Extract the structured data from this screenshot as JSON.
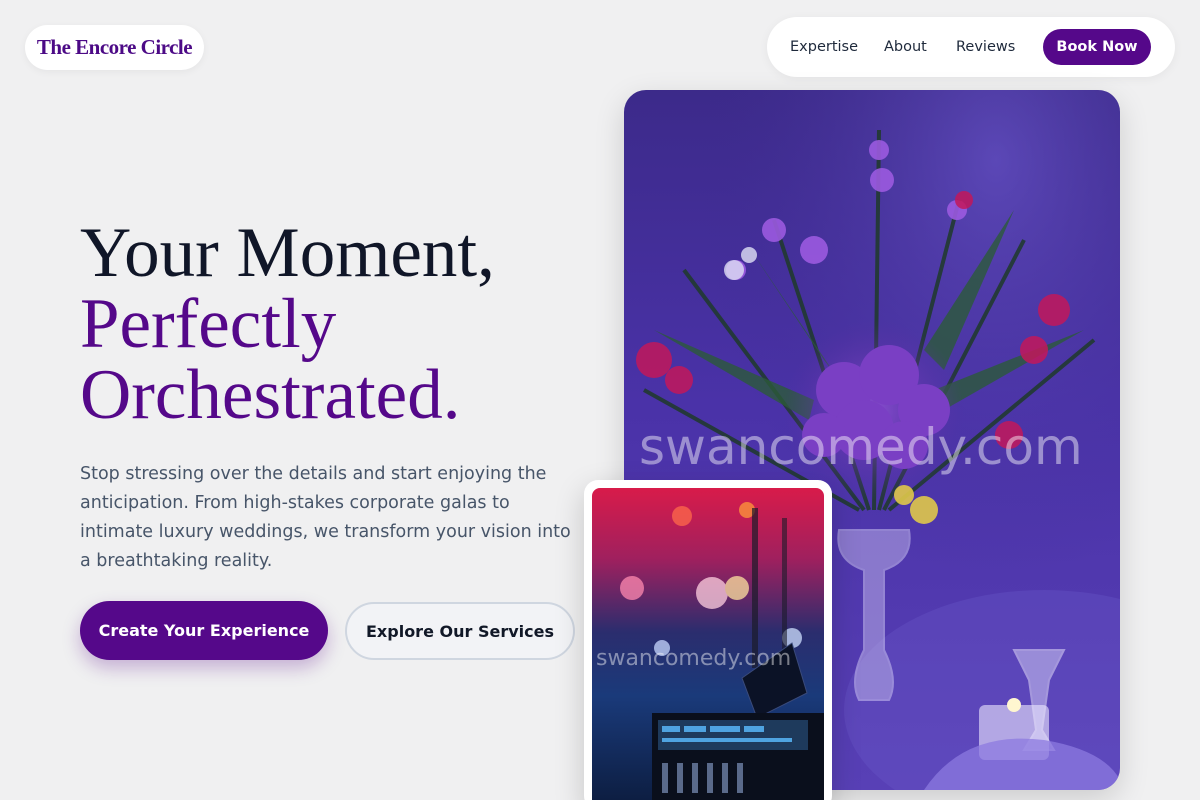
{
  "brand": {
    "name": "The Encore Circle"
  },
  "nav": {
    "items": [
      {
        "label": "Expertise"
      },
      {
        "label": "About"
      },
      {
        "label": "Reviews"
      }
    ],
    "cta_label": "Book Now"
  },
  "hero": {
    "title_line1": "Your Moment,",
    "title_line2": "Perfectly",
    "title_line3": "Orchestrated.",
    "subtitle": "Stop stressing over the details and start enjoying the anticipation. From high-stakes corporate galas to intimate luxury weddings, we transform your vision into a breathtaking reality.",
    "primary_cta": "Create Your Experience",
    "secondary_cta": "Explore Our Services"
  },
  "images": {
    "main_watermark": "swancomedy.com",
    "small_watermark": "swancomedy.com"
  },
  "colors": {
    "accent": "#55088a",
    "background": "#f0f0f1",
    "heading": "#101628",
    "body_text": "#475569"
  }
}
